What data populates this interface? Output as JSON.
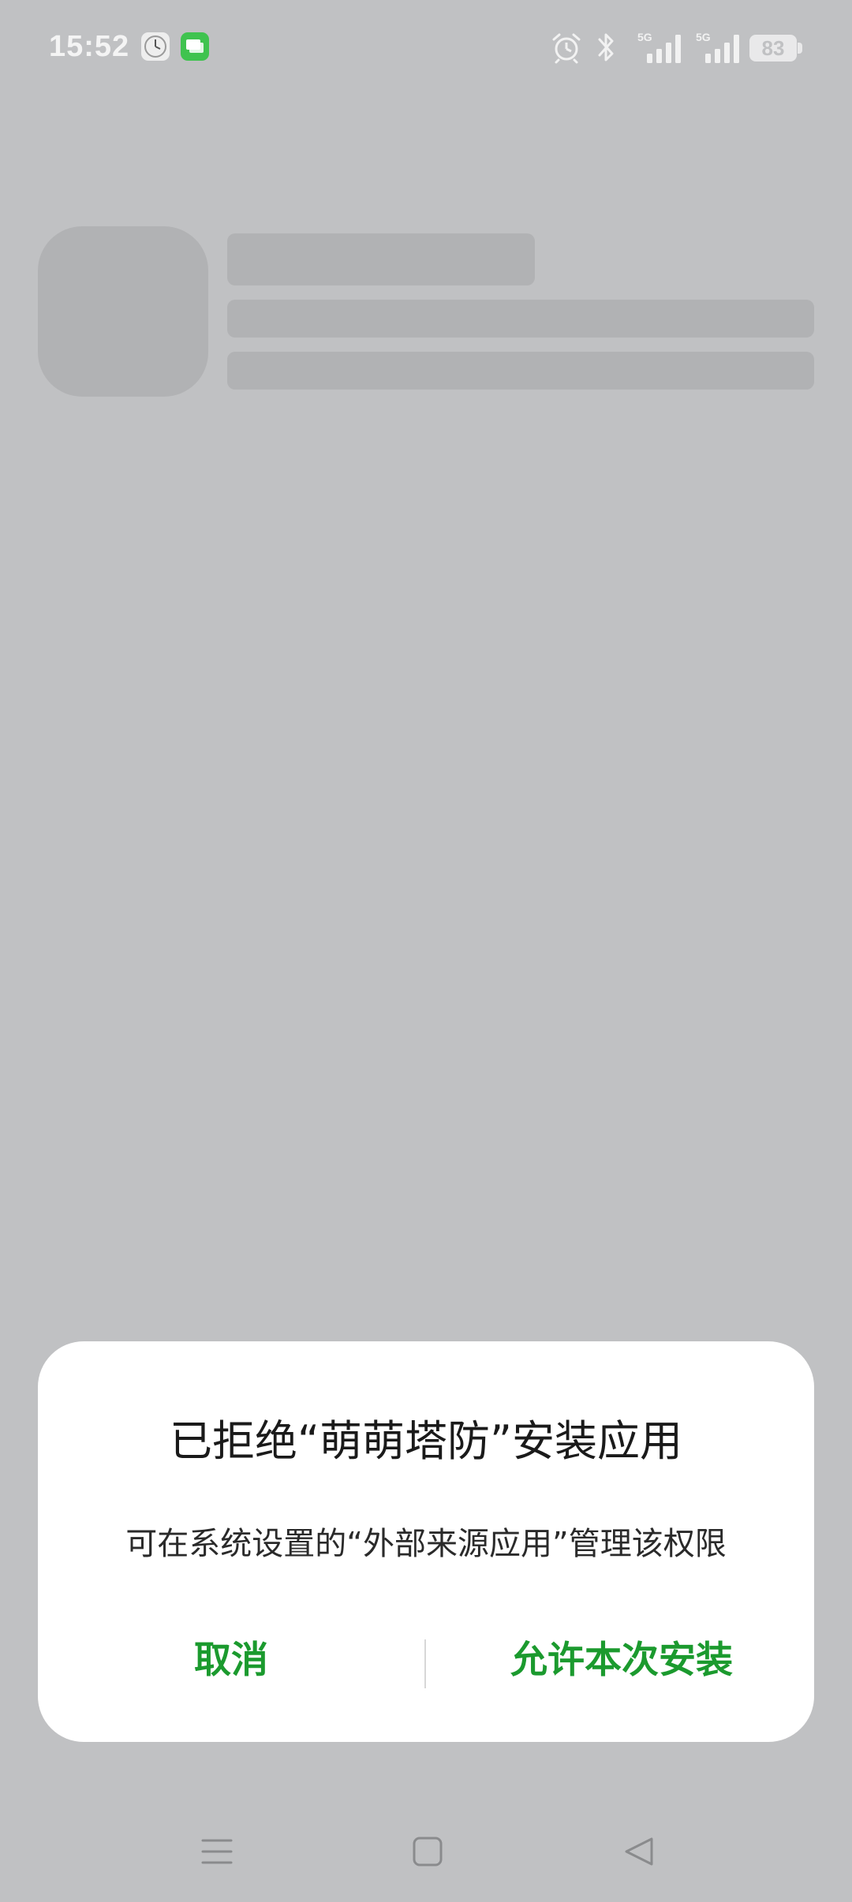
{
  "status_bar": {
    "time": "15:52",
    "notification_icons": [
      "clock-app-icon",
      "message-app-icon"
    ],
    "system_icons": [
      "alarm-icon",
      "bluetooth-icon",
      "signal-5g-icon",
      "signal-5g-icon"
    ],
    "signal_1_label": "5G",
    "signal_2_label": "5G",
    "battery_level": "83"
  },
  "dialog": {
    "title": "已拒绝“萌萌塔防”安装应用",
    "message": "可在系统设置的“外部来源应用”管理该权限",
    "cancel_label": "取消",
    "allow_label": "允许本次安装"
  },
  "navigation_bar": {
    "icons": [
      "menu-icon",
      "home-icon",
      "back-icon"
    ]
  },
  "colors": {
    "background": "#c0c1c3",
    "skeleton": "#b1b2b4",
    "accent": "#1b9a2e",
    "dialog_background": "#ffffff"
  }
}
